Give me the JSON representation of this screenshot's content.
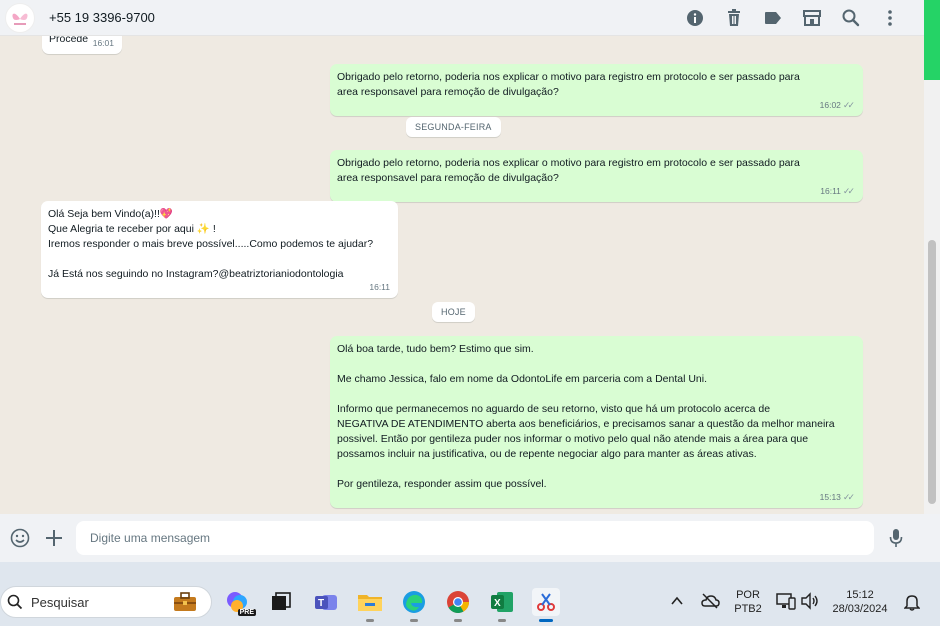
{
  "header": {
    "contact": "+55 19 3396-9700",
    "icons": [
      "info-icon",
      "trash-icon",
      "label-icon",
      "shop-icon",
      "search-icon",
      "menu-dots-icon"
    ]
  },
  "chat": {
    "partial_first": {
      "text": "Procede",
      "time": "16:01"
    },
    "messages": [
      {
        "dir": "out",
        "text": "Obrigado pelo retorno, poderia nos explicar o motivo para registro em protocolo e ser passado para\narea responsavel para remoção de divulgação?",
        "time": "16:02"
      },
      {
        "dir": "out",
        "text": "Obrigado pelo retorno, poderia nos explicar o motivo para registro em protocolo e ser passado para\narea responsavel para remoção de divulgação?",
        "time": "16:11"
      },
      {
        "dir": "in",
        "text": "Olá Seja bem Vindo(a)!!💖\nQue Alegria te receber por aqui ✨ !\nIremos responder o mais breve possível.....Como podemos te ajudar?\n\nJá Está nos seguindo no Instagram?@beatriztorianiodontologia",
        "time": "16:11"
      },
      {
        "dir": "out",
        "text": "Olá boa tarde, tudo bem? Estimo que sim.\n\nMe chamo Jessica, falo em nome da OdontoLife em parceria com a Dental Uni.\n\nInformo que permanecemos no aguardo de seu retorno, visto que há um protocolo acerca de\nNEGATIVA DE ATENDIMENTO aberta aos beneficiários, e precisamos sanar a questão da melhor maneira\npossivel. Então por gentileza puder nos informar o motivo pelo qual não atende mais a área para que\npossamos incluir na justificativa, ou de repente negociar algo para manter as áreas ativas.\n\nPor gentileza, responder assim que possível.",
        "time": "15:13"
      }
    ],
    "day_chips": [
      "SEGUNDA-FEIRA",
      "HOJE"
    ]
  },
  "composer": {
    "placeholder": "Digite uma mensagem"
  },
  "taskbar": {
    "search_label": "Pesquisar",
    "lang_line1": "POR",
    "lang_line2": "PTB2",
    "time": "15:12",
    "date": "28/03/2024",
    "copilot_badge": "PRE"
  },
  "colors": {
    "out_bubble": "#d9fdd3",
    "in_bubble": "#ffffff",
    "accent": "#25d366"
  }
}
